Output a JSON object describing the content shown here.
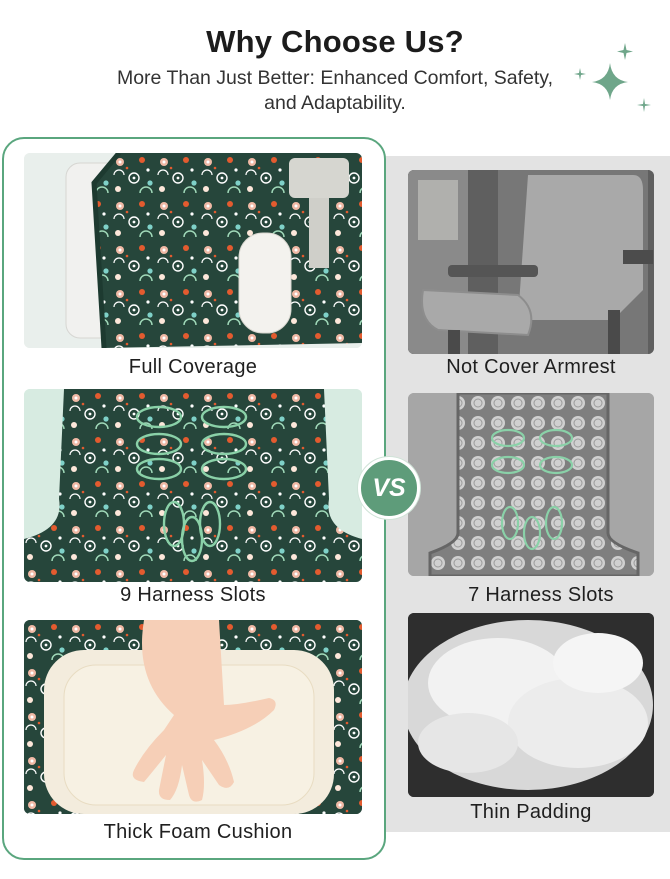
{
  "header": {
    "title": "Why Choose Us?",
    "subtitle": "More Than Just Better: Enhanced Comfort, Safety, and Adaptability."
  },
  "vs_label": "VS",
  "ours": {
    "items": [
      {
        "label": "Full Coverage"
      },
      {
        "label": "9 Harness Slots"
      },
      {
        "label": "Thick Foam Cushion"
      }
    ]
  },
  "theirs": {
    "items": [
      {
        "label": "Not Cover Armrest"
      },
      {
        "label": "7 Harness Slots"
      },
      {
        "label": "Thin Padding"
      }
    ]
  },
  "colors": {
    "accent_green": "#5aa67e",
    "pad_dark_green": "#24453a",
    "mint_bg": "#d7ebe1",
    "competitor_gray": "#7c7c7c",
    "panel_gray": "#e3e3e3"
  }
}
